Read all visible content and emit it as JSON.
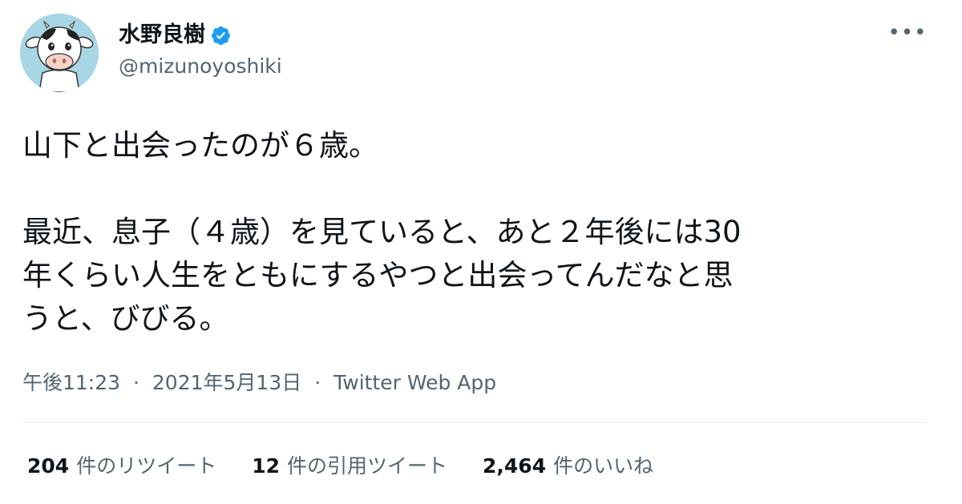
{
  "user": {
    "display_name": "水野良樹",
    "handle": "@mizunoyoshiki",
    "verified": true,
    "avatar_icon": "cow-avatar-icon"
  },
  "tweet": {
    "lines": [
      "山下と出会ったのが６歳。",
      "",
      "最近、息子（４歳）を見ていると、あと２年後には30",
      "年くらい人生をともにするやつと出会ってんだなと思",
      "うと、びびる。"
    ],
    "time": "午後11:23",
    "separator": "·",
    "date": "2021年5月13日",
    "source": "Twitter Web App"
  },
  "stats": {
    "retweets_count": "204",
    "retweets_label": "件のリツイート",
    "quotes_count": "12",
    "quotes_label": "件の引用ツイート",
    "likes_count": "2,464",
    "likes_label": "件のいいね"
  },
  "menu": {
    "more_label": "•••"
  },
  "colors": {
    "text": "#0f1419",
    "secondary": "#536471",
    "verified": "#1d9bf0",
    "avatar_bg": "#a9d6e5",
    "divider": "#e6e9ea"
  }
}
